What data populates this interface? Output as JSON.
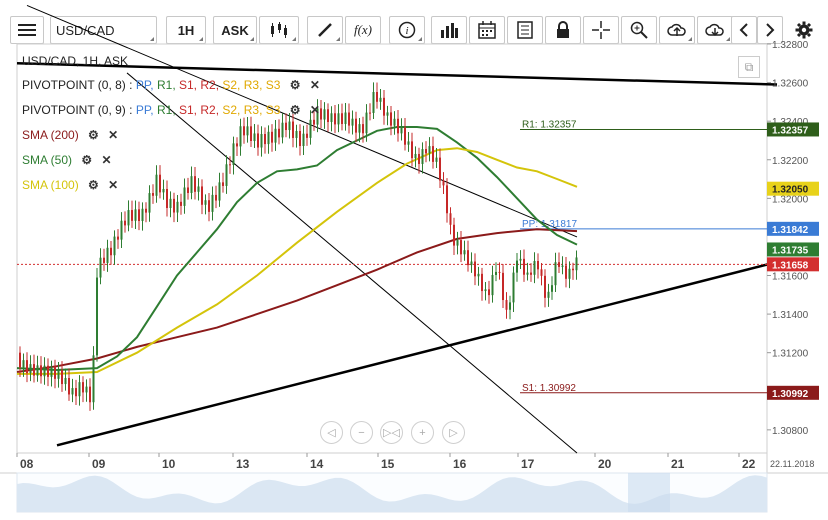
{
  "toolbar": {
    "symbol": "USD/CAD",
    "timeframe": "1H",
    "price_type": "ASK",
    "fx_label": "f(x)"
  },
  "legend": {
    "header": "USD/CAD, 1H, ASK",
    "pivot1": {
      "name": "PIVOTPOINT (0, 8)",
      "sep": ":",
      "labels": [
        "PP,",
        "R1,",
        "S1,",
        "R2,",
        "S2,",
        "R3,",
        "S3"
      ]
    },
    "pivot2": {
      "name": "PIVOTPOINT (0, 9)",
      "sep": ":",
      "labels": [
        "PP,",
        "R1,",
        "S1,",
        "R2,",
        "S2,",
        "R3,",
        "S3"
      ]
    },
    "pivot_colors": [
      "#3a7bd5",
      "#2e7d32",
      "#c62828",
      "#c62828",
      "#e0a800",
      "#e0a800",
      "#e0a800"
    ],
    "sma200": {
      "label": "SMA (200)",
      "color": "#8b1a1a"
    },
    "sma50": {
      "label": "SMA (50)",
      "color": "#2e7d32"
    },
    "sma100": {
      "label": "SMA (100)",
      "color": "#d4c40a"
    }
  },
  "chart_data": {
    "type": "line",
    "title": "USD/CAD, 1H, ASK",
    "ylim": [
      1.3068,
      1.328
    ],
    "y_ticks": [
      "1.32800",
      "1.32600",
      "1.32400",
      "1.32200",
      "1.32000",
      "1.31600",
      "1.31400",
      "1.31200",
      "1.30800"
    ],
    "x_ticks": [
      "08",
      "09",
      "10",
      "13",
      "14",
      "15",
      "16",
      "17",
      "20",
      "21",
      "22"
    ],
    "x_end_label": "22.11.2018",
    "levels": [
      {
        "name": "R1",
        "label": "R1: 1.32357",
        "value": 1.32357,
        "tag": "1.32357",
        "color": "#2e5e1a"
      },
      {
        "name": "PP",
        "label": "PP: 1.31817",
        "value": 1.31842,
        "tag": "1.31842",
        "color": "#3a7bd5"
      },
      {
        "name": "S1",
        "label": "S1: 1.30992",
        "value": 1.30992,
        "tag": "1.30992",
        "color": "#8b1a1a"
      }
    ],
    "price_tags": [
      {
        "value": 1.3205,
        "tag": "1.32050",
        "color": "#e8d21a",
        "text_color": "#222"
      },
      {
        "value": 1.31735,
        "tag": "1.31735",
        "color": "#2e7d32",
        "text_color": "#ffffff"
      },
      {
        "value": 1.31658,
        "tag": "1.31658",
        "color": "#d32f2f",
        "text_color": "#ffffff"
      }
    ],
    "last_price": 1.31658,
    "series": [
      {
        "name": "SMA (200)",
        "color": "#8b1a1a",
        "x": [
          0,
          40,
          80,
          120,
          160,
          200,
          240,
          280,
          320,
          360,
          400,
          440,
          480,
          520,
          560
        ],
        "y": [
          1.311,
          1.3113,
          1.3117,
          1.3123,
          1.3128,
          1.3133,
          1.314,
          1.3147,
          1.3155,
          1.3163,
          1.3172,
          1.3179,
          1.3182,
          1.3184,
          1.3183
        ]
      },
      {
        "name": "SMA (50)",
        "color": "#2e7d32",
        "x": [
          0,
          40,
          80,
          100,
          120,
          140,
          160,
          180,
          200,
          220,
          240,
          260,
          280,
          300,
          320,
          340,
          360,
          380,
          400,
          420,
          440,
          460,
          480,
          500,
          520,
          540,
          560
        ],
        "y": [
          1.3112,
          1.3111,
          1.3112,
          1.3118,
          1.3128,
          1.3144,
          1.316,
          1.3172,
          1.3184,
          1.3198,
          1.3208,
          1.3214,
          1.3215,
          1.3217,
          1.3225,
          1.323,
          1.3235,
          1.3237,
          1.3237,
          1.3236,
          1.3229,
          1.3221,
          1.3211,
          1.32,
          1.3189,
          1.3181,
          1.3176
        ]
      },
      {
        "name": "SMA (100)",
        "color": "#d4c40a",
        "x": [
          0,
          40,
          80,
          120,
          160,
          200,
          240,
          280,
          320,
          360,
          390,
          420,
          440,
          460,
          480,
          500,
          520,
          540,
          560
        ],
        "y": [
          1.3109,
          1.3109,
          1.311,
          1.312,
          1.3133,
          1.3145,
          1.316,
          1.3177,
          1.3193,
          1.3208,
          1.3218,
          1.3225,
          1.3226,
          1.3224,
          1.322,
          1.3216,
          1.3214,
          1.321,
          1.3206
        ]
      },
      {
        "name": "Price",
        "color": "#333333",
        "x": [
          0,
          15,
          30,
          45,
          55,
          65,
          75,
          80,
          85,
          95,
          110,
          125,
          140,
          150,
          160,
          175,
          190,
          205,
          215,
          225,
          240,
          255,
          270,
          285,
          300,
          315,
          330,
          345,
          358,
          370,
          385,
          400,
          410,
          420,
          428,
          435,
          445,
          460,
          470,
          480,
          490,
          500,
          510,
          520,
          530,
          540,
          550,
          560
        ],
        "y": [
          1.312,
          1.3114,
          1.3108,
          1.3103,
          1.3098,
          1.3106,
          1.31,
          1.3165,
          1.317,
          1.3172,
          1.3187,
          1.3192,
          1.3214,
          1.32,
          1.3193,
          1.3205,
          1.3195,
          1.3212,
          1.3226,
          1.3235,
          1.3225,
          1.3232,
          1.3243,
          1.323,
          1.324,
          1.3239,
          1.3245,
          1.3238,
          1.3253,
          1.3238,
          1.3233,
          1.3223,
          1.323,
          1.3218,
          1.3198,
          1.3175,
          1.317,
          1.3163,
          1.3153,
          1.3168,
          1.3137,
          1.3166,
          1.3156,
          1.3168,
          1.315,
          1.3172,
          1.316,
          1.3165
        ]
      }
    ],
    "trendlines": [
      {
        "name": "upper channel",
        "from": [
          10,
          1.33
        ],
        "to": [
          560,
          1.318
        ]
      },
      {
        "name": "lower channel",
        "from": [
          110,
          1.3265
        ],
        "to": [
          560,
          1.3068
        ]
      },
      {
        "name": "top flat",
        "from": [
          0,
          1.327
        ],
        "to": [
          760,
          1.3259
        ]
      },
      {
        "name": "support",
        "from": [
          40,
          1.3072
        ],
        "to": [
          760,
          1.3167
        ]
      }
    ]
  },
  "nav": {
    "prev": "◁",
    "zoom_out": "−",
    "fit": "▷◁",
    "zoom_in": "+",
    "next": "▷"
  }
}
